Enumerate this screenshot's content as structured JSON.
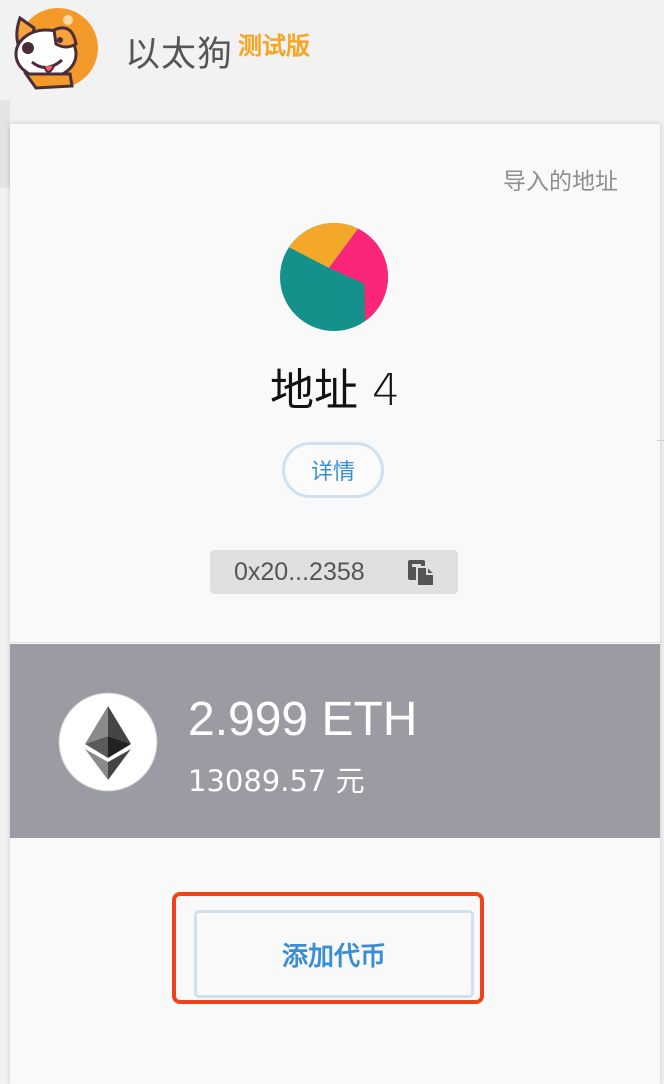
{
  "header": {
    "app_title": "以太狗",
    "beta_badge": "测试版",
    "logo_icon": "dog-mascot-icon"
  },
  "account": {
    "type_label": "导入的地址",
    "name": "地址 4",
    "details_button": "详情",
    "address_short": "0x20...2358",
    "copy_icon": "copy-icon",
    "avatar_colors": [
      "#f3a829",
      "#fb2579",
      "#13918a"
    ]
  },
  "balance": {
    "token_icon": "ethereum-icon",
    "amount": "2.999 ETH",
    "fiat": "13089.57 元",
    "band_color": "#9b9ba4"
  },
  "actions": {
    "add_token_button": "添加代币",
    "highlight_color": "#f0431c"
  }
}
